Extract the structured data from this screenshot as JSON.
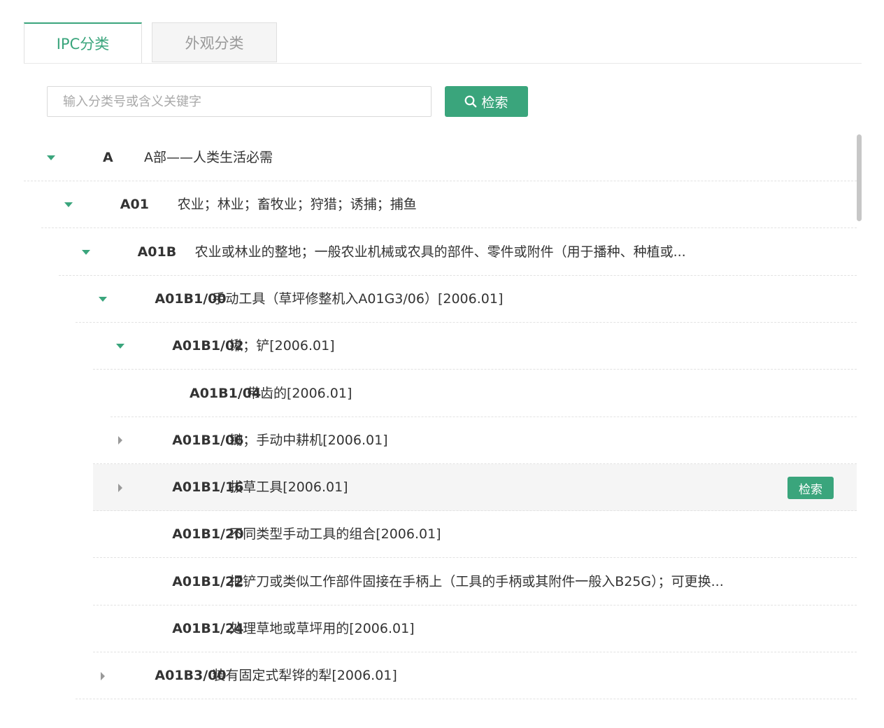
{
  "tabs": [
    {
      "label": "IPC分类",
      "active": true
    },
    {
      "label": "外观分类",
      "active": false
    }
  ],
  "search": {
    "placeholder": "输入分类号或含义关键字",
    "button_label": "检索",
    "icon": "search-icon"
  },
  "tree": [
    {
      "code": "A",
      "desc": "A部——人类生活必需",
      "toggle": "expanded"
    },
    {
      "code": "A01",
      "desc": "农业；林业；畜牧业；狩猎；诱捕；捕鱼",
      "toggle": "expanded"
    },
    {
      "code": "A01B",
      "desc": "农业或林业的整地；一般农业机械或农具的部件、零件或附件（用于播种、种植或...",
      "toggle": "expanded"
    },
    {
      "code": "A01B1/00",
      "desc": "手动工具（草坪修整机入A01G3/06）[2006.01]",
      "toggle": "expanded"
    },
    {
      "code": "A01B1/02",
      "desc": "锹；铲[2006.01]",
      "toggle": "expanded"
    },
    {
      "code": "A01B1/04",
      "desc": "带齿的[2006.01]",
      "toggle": "none"
    },
    {
      "code": "A01B1/06",
      "desc": "锄；手动中耕机[2006.01]",
      "toggle": "collapsed"
    },
    {
      "code": "A01B1/16",
      "desc": "拔草工具[2006.01]",
      "toggle": "collapsed",
      "highlighted": true,
      "action_label": "检索"
    },
    {
      "code": "A01B1/20",
      "desc": "不同类型手动工具的组合[2006.01]",
      "toggle": "none"
    },
    {
      "code": "A01B1/22",
      "desc": "把铲刀或类似工作部件固接在手柄上（工具的手柄或其附件一般入B25G）；可更换...",
      "toggle": "none"
    },
    {
      "code": "A01B1/24",
      "desc": "处理草地或草坪用的[2006.01]",
      "toggle": "none"
    },
    {
      "code": "A01B3/00",
      "desc": "装有固定式犁铧的犁[2006.01]",
      "toggle": "collapsed"
    }
  ],
  "colors": {
    "accent": "#3aa57c",
    "text": "#333333",
    "muted": "#999999",
    "highlight_bg": "#f5f5f5"
  }
}
